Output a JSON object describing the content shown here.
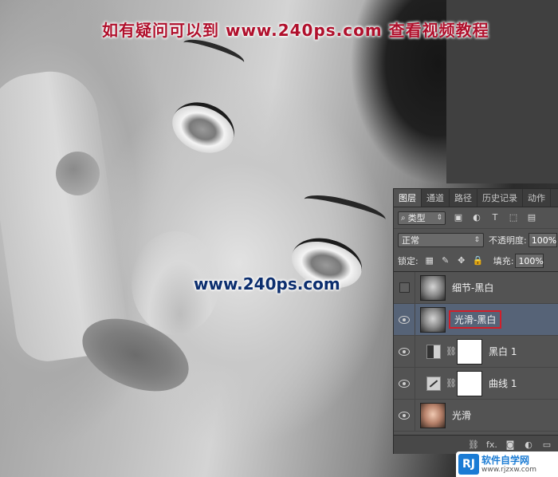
{
  "captions": {
    "top": "如有疑问可以到 www.240ps.com 查看视频教程",
    "middle": "www.240ps.com"
  },
  "panel": {
    "tabs": [
      {
        "label": "图层",
        "active": true
      },
      {
        "label": "通道",
        "active": false
      },
      {
        "label": "路径",
        "active": false
      },
      {
        "label": "历史记录",
        "active": false
      },
      {
        "label": "动作",
        "active": false
      }
    ],
    "filter": {
      "label": "类型",
      "icons": [
        "image-filter-icon",
        "adjustment-filter-icon",
        "type-filter-icon",
        "shape-filter-icon",
        "smart-filter-icon"
      ]
    },
    "blend_mode": "正常",
    "opacity_label": "不透明度:",
    "opacity_value": "100%",
    "lock_label": "锁定:",
    "fill_label": "填充:",
    "fill_value": "100%",
    "layers": [
      {
        "name": "细节-黑白",
        "visible": false,
        "type": "image",
        "selected": false
      },
      {
        "name": "光滑-黑白",
        "visible": true,
        "type": "image",
        "selected": true
      },
      {
        "name": "黑白 1",
        "visible": true,
        "type": "bw-adjustment",
        "selected": false
      },
      {
        "name": "曲线 1",
        "visible": true,
        "type": "curves-adjustment",
        "selected": false
      },
      {
        "name": "光滑",
        "visible": true,
        "type": "color-image",
        "selected": false
      }
    ],
    "footer_icons": [
      "link-layers-icon",
      "fx-icon",
      "add-mask-icon",
      "new-adjustment-icon",
      "new-group-icon",
      "new-layer-icon"
    ],
    "footer_fx": "fx."
  },
  "watermark": {
    "logo": "RJ",
    "title": "软件自学网",
    "url": "www.rjzxw.com"
  }
}
